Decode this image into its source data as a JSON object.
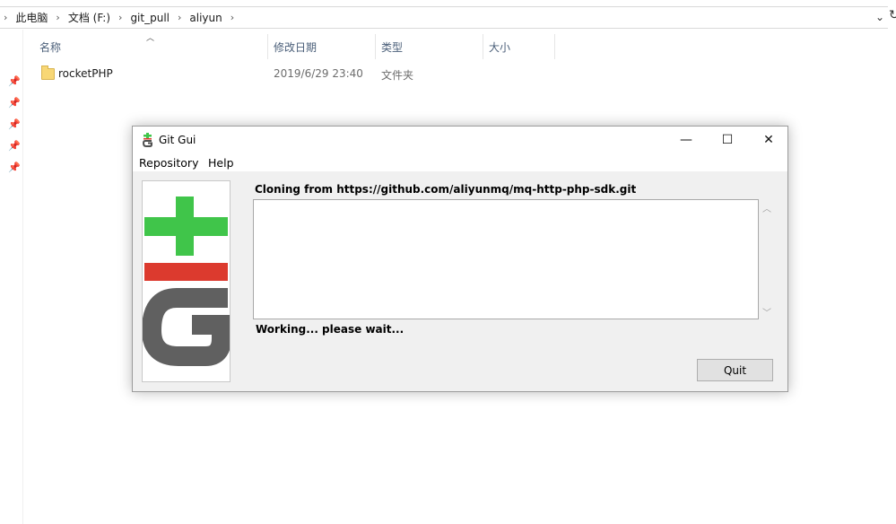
{
  "explorer": {
    "breadcrumb": [
      "此电脑",
      "文档 (F:)",
      "git_pull",
      "aliyun"
    ],
    "columns": [
      "名称",
      "修改日期",
      "类型",
      "大小"
    ],
    "files": [
      {
        "name": "rocketPHP",
        "modified": "2019/6/29 23:40",
        "type": "文件夹",
        "size": ""
      }
    ],
    "icons": {
      "pin": "pin-icon",
      "folder": "folder-icon",
      "refresh": "refresh-icon",
      "dropdown": "chevron-down-icon"
    }
  },
  "gitgui": {
    "window_title": "Git Gui",
    "menu": [
      "Repository",
      "Help"
    ],
    "cloning_text": "Cloning from https://github.com/aliyunmq/mq-http-php-sdk.git",
    "status_text": "Working... please wait...",
    "quit_label": "Quit",
    "logo_colors": {
      "plus": "#40c54a",
      "bar": "#dc3a2e",
      "g": "#606060"
    },
    "buttons": {
      "minimize": "—",
      "maximize": "☐",
      "close": "✕"
    }
  }
}
